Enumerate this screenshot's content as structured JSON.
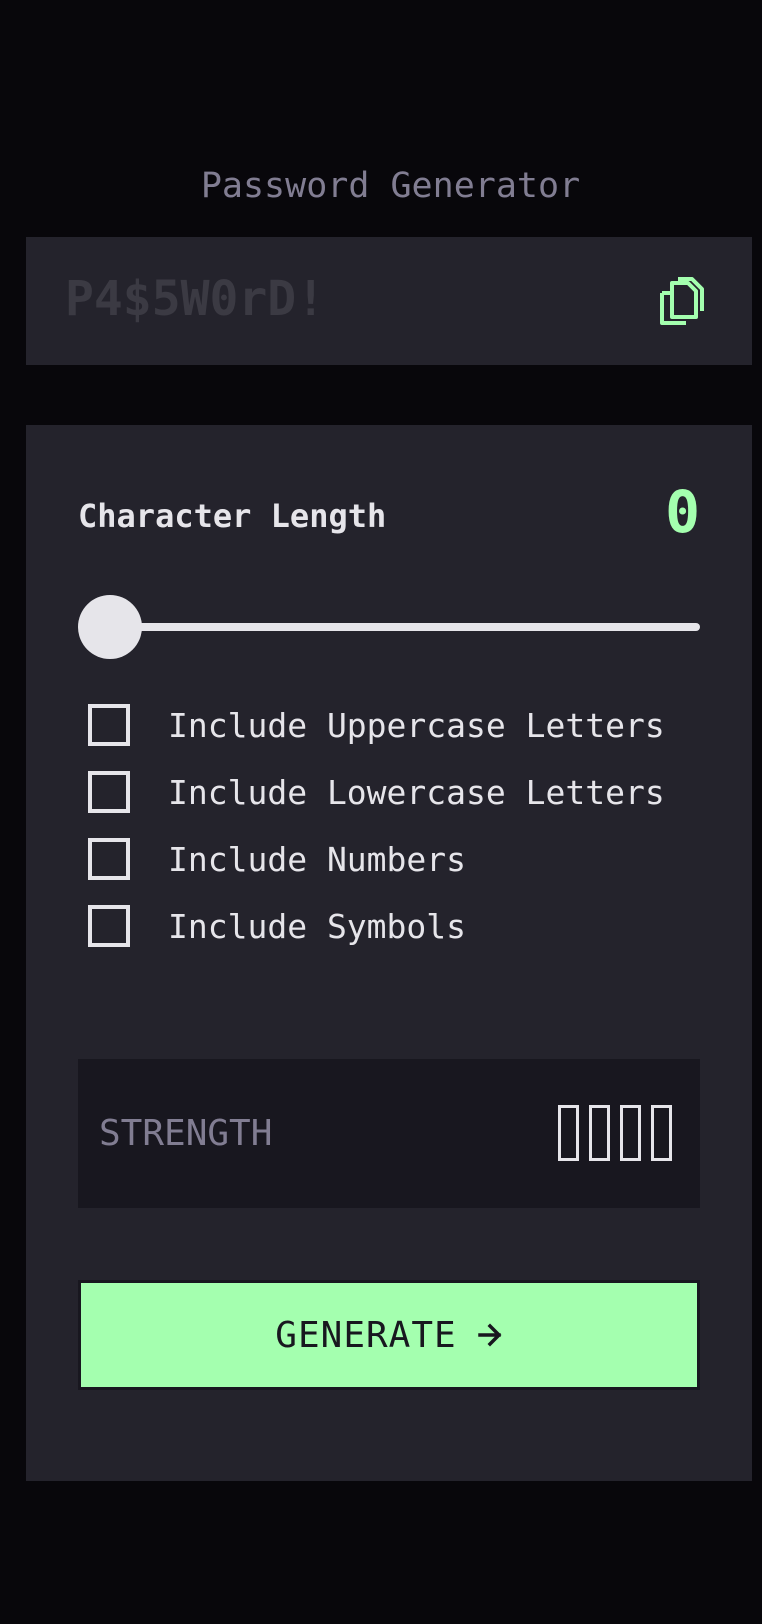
{
  "app": {
    "title": "Password Generator"
  },
  "output": {
    "password": "P4$5W0rD!",
    "copy_icon": "copy-icon"
  },
  "length": {
    "label": "Character Length",
    "value": "0"
  },
  "options": [
    {
      "label": "Include Uppercase Letters",
      "checked": false
    },
    {
      "label": "Include Lowercase Letters",
      "checked": false
    },
    {
      "label": "Include Numbers",
      "checked": false
    },
    {
      "label": "Include Symbols",
      "checked": false
    }
  ],
  "strength": {
    "label": "STRENGTH",
    "bars_filled": 0,
    "bars_total": 4
  },
  "generate": {
    "label": "GENERATE",
    "icon": "arrow-right-icon"
  },
  "colors": {
    "accent": "#A4FFAF",
    "background": "#08070B",
    "panel": "#24232C",
    "muted": "#817D92",
    "text": "#E6E5EA"
  }
}
